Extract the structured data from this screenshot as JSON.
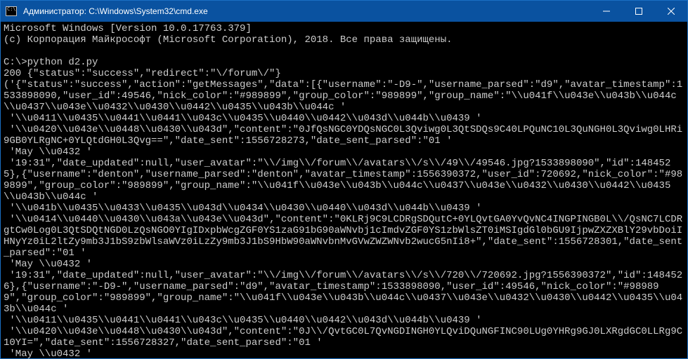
{
  "window": {
    "title": "Администратор: C:\\Windows\\System32\\cmd.exe"
  },
  "terminal": {
    "lines": [
      "Microsoft Windows [Version 10.0.17763.379]",
      "(c) Корпорация Майкрософт (Microsoft Corporation), 2018. Все права защищены.",
      "",
      "C:\\>python d2.py",
      "200 {\"status\":\"success\",\"redirect\":\"\\/forum\\/\"}",
      "('{\"status\":\"success\",\"action\":\"getMessages\",\"data\":[{\"username\":\"-D9-\",\"username_parsed\":\"d9\",\"avatar_timestamp\":1533898090,\"user_id\":49546,\"nick_color\":\"#989899\",\"group_color\":\"989899\",\"group_name\":\"\\\\u041f\\\\u043e\\\\u043b\\\\u044c\\\\u0437\\\\u043e\\\\u0432\\\\u0430\\\\u0442\\\\u0435\\\\u043b\\\\u044c '",
      " '\\\\u0411\\\\u0435\\\\u0441\\\\u0441\\\\u043c\\\\u0435\\\\u0440\\\\u0442\\\\u043d\\\\u044b\\\\u0439 '",
      " '\\\\u0420\\\\u043e\\\\u0448\\\\u0430\\\\u043d\",\"content\":\"0JfQsNGC0YDQsNGC0L3Qviwg0L3QtSDQs9C40LPQuNC10L3QuNGH0L3Qviwg0LHRi9GB0YLRgNC+0YLQtdGH0L3Qvg==\",\"date_sent\":1556728273,\"date_sent_parsed\":\"01 '",
      " 'May \\\\u0432 '",
      " '19:31\",\"date_updated\":null,\"user_avatar\":\"\\\\/img\\\\/forum\\\\/avatars\\\\/s\\\\/49\\\\/49546.jpg?1533898090\",\"id\":1484525},{\"username\":\"denton\",\"username_parsed\":\"denton\",\"avatar_timestamp\":1556390372,\"user_id\":720692,\"nick_color\":\"#989899\",\"group_color\":\"989899\",\"group_name\":\"\\\\u041f\\\\u043e\\\\u043b\\\\u044c\\\\u0437\\\\u043e\\\\u0432\\\\u0430\\\\u0442\\\\u0435\\\\u043b\\\\u044c '",
      " '\\\\u041b\\\\u0435\\\\u0433\\\\u0435\\\\u043d\\\\u0434\\\\u0430\\\\u0440\\\\u043d\\\\u044b\\\\u0439 '",
      " '\\\\u0414\\\\u0440\\\\u0430\\\\u043a\\\\u043e\\\\u043d\",\"content\":\"0KLRj9C9LCDRgSDQutC+0YLQvtGA0YvQvNC4INGPINGB0L\\\\/QsNC7LCDRgtCw0Log0L3QtSDQtNGD0LzQsNGO0YIgIDxpbWcgZGF0YS1zaG91bG90aWNvbj1cImdvZGF0YS1zbWlsZT0iMSIgdGl0bGU9IjpwZXZXBlY29vbDoiIHNyYz0iL2ltZy9mb3J1bS9zbWlsaWVz0iLzZy9mb3J1bS9HbW90aWNvbnMvGVwZWZWNvb2wucG5nIi8+\",\"date_sent\":1556728301,\"date_sent_parsed\":\"01 '",
      " 'May \\\\u0432 '",
      " '19:31\",\"date_updated\":null,\"user_avatar\":\"\\\\/img\\\\/forum\\\\/avatars\\\\/s\\\\/720\\\\/720692.jpg?1556390372\",\"id\":1484526},{\"username\":\"-D9-\",\"username_parsed\":\"d9\",\"avatar_timestamp\":1533898090,\"user_id\":49546,\"nick_color\":\"#989899\",\"group_color\":\"989899\",\"group_name\":\"\\\\u041f\\\\u043e\\\\u043b\\\\u044c\\\\u0437\\\\u043e\\\\u0432\\\\u0430\\\\u0442\\\\u0435\\\\u043b\\\\u044c '",
      " '\\\\u0411\\\\u0435\\\\u0441\\\\u0441\\\\u043c\\\\u0435\\\\u0440\\\\u0442\\\\u043d\\\\u044b\\\\u0439 '",
      " '\\\\u0420\\\\u043e\\\\u0448\\\\u0430\\\\u043d\",\"content\":\"0J\\\\/QvtGC0L7QvNGDINGH0YLQviDQuNGFINC90LUg0YHRg9GJ0LXRgdGC0LLRg9C10YI=\",\"date_sent\":1556728327,\"date_sent_parsed\":\"01 '",
      " 'May \\\\u0432 '"
    ]
  }
}
